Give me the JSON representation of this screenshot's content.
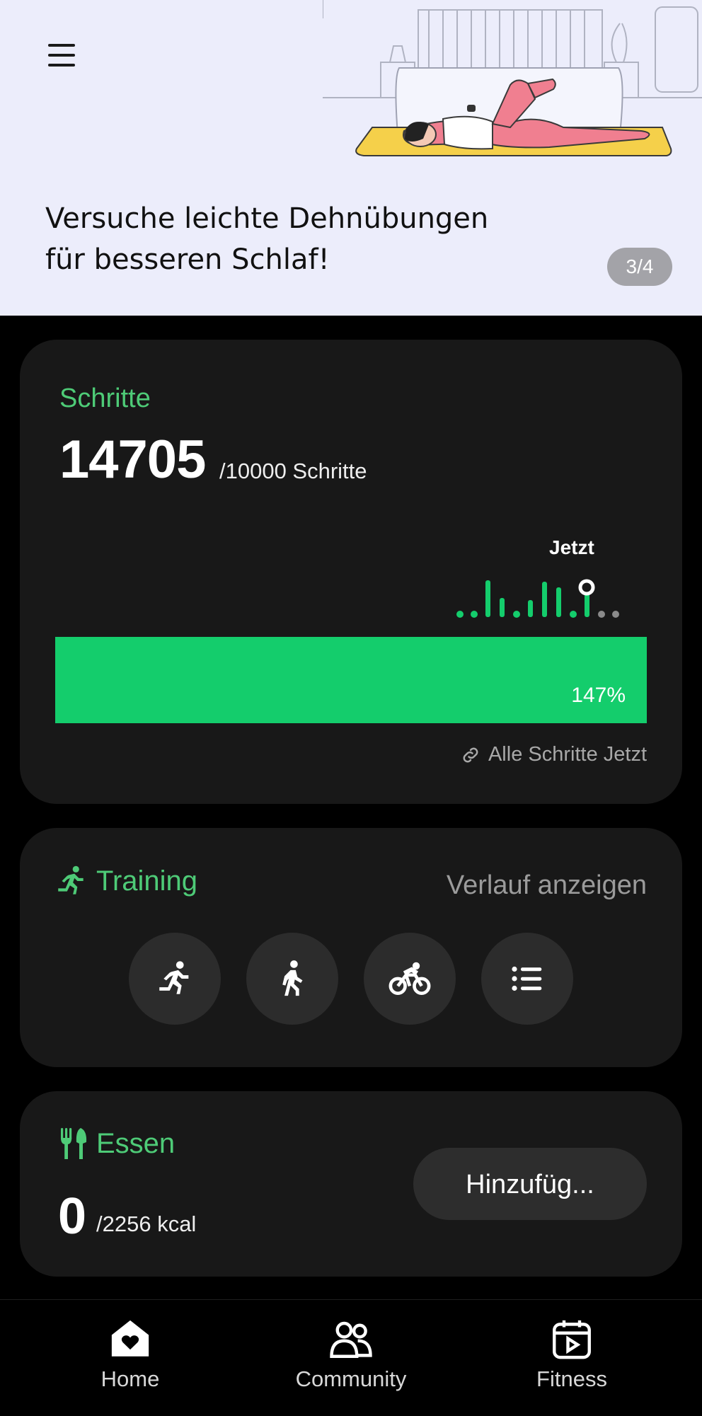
{
  "banner": {
    "title_line1": "Versuche leichte Dehnübungen",
    "title_line2": "für besseren Schlaf!",
    "page_indicator": "3/4",
    "background": "#ecedfb"
  },
  "steps": {
    "title": "Schritte",
    "value": "14705",
    "goal": "/10000 Schritte",
    "now_label": "Jetzt",
    "progress_percent_label": "147%",
    "progress_fraction": 1.0,
    "link_label": "Alle Schritte Jetzt",
    "accent_color": "#14cd6c"
  },
  "training": {
    "title": "Training",
    "history_label": "Verlauf anzeigen",
    "activities": [
      {
        "icon": "running-icon"
      },
      {
        "icon": "walking-icon"
      },
      {
        "icon": "cycling-icon"
      },
      {
        "icon": "list-icon"
      }
    ]
  },
  "food": {
    "title": "Essen",
    "value": "0",
    "goal": "/2256 kcal",
    "add_label": "Hinzufüg..."
  },
  "nav": {
    "items": [
      {
        "label": "Home",
        "icon": "home-icon"
      },
      {
        "label": "Community",
        "icon": "community-icon"
      },
      {
        "label": "Fitness",
        "icon": "fitness-icon"
      }
    ]
  },
  "colors": {
    "accent_green": "#4ecb77",
    "card_background": "#181818",
    "page_background": "#000000"
  }
}
